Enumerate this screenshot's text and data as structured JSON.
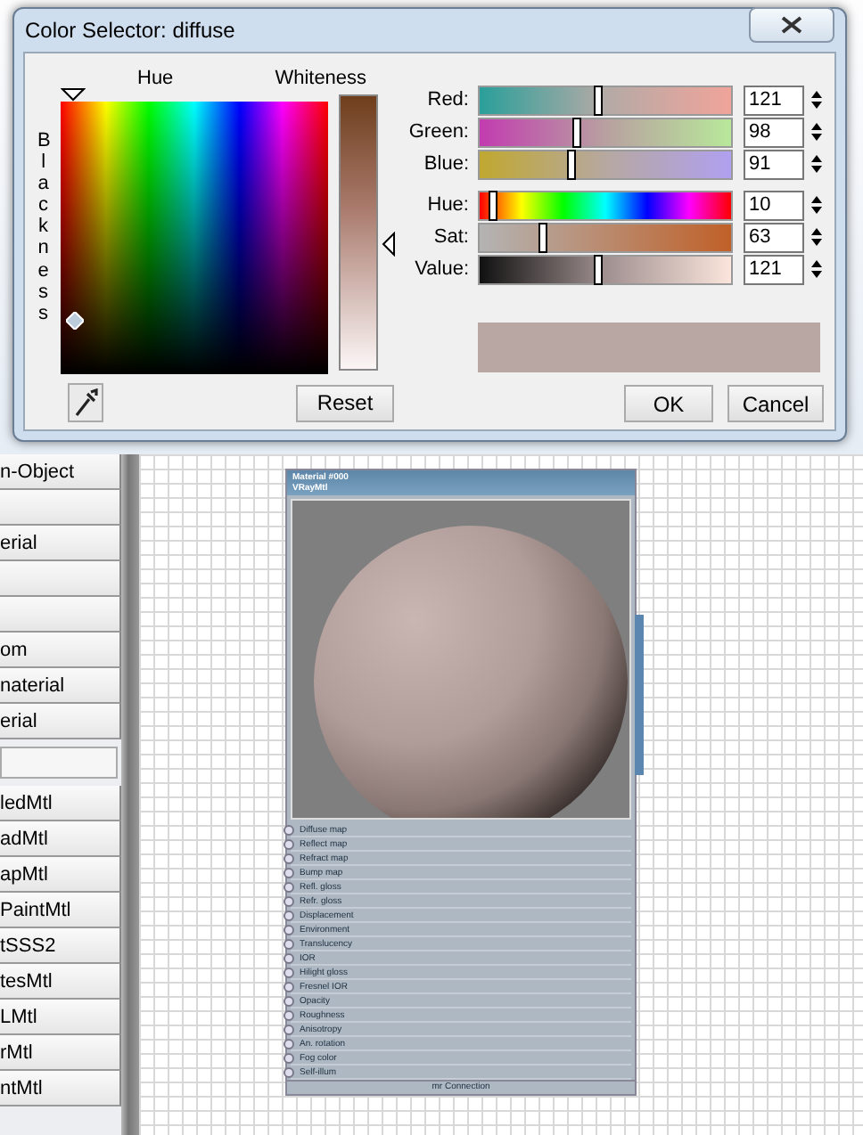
{
  "dialog": {
    "title": "Color Selector: diffuse",
    "hue_label": "Hue",
    "whiteness_label": "Whiteness",
    "blackness_label": "Blackness",
    "channels": [
      {
        "kind": "red",
        "name": "Red:",
        "level": 0.47,
        "value": "121"
      },
      {
        "kind": "green",
        "name": "Green:",
        "level": 0.38,
        "value": "98"
      },
      {
        "kind": "blue",
        "name": "Blue:",
        "level": 0.36,
        "value": "91"
      },
      {
        "kind": "hue",
        "name": "Hue:",
        "level": 0.05,
        "value": "10"
      },
      {
        "kind": "sat",
        "name": "Sat:",
        "level": 0.25,
        "value": "63"
      },
      {
        "kind": "value",
        "name": "Value:",
        "level": 0.47,
        "value": "121"
      }
    ],
    "reset": "Reset",
    "ok": "OK",
    "cancel": "Cancel"
  },
  "material_list": [
    {
      "kind": "button",
      "label": "n-Object"
    },
    {
      "kind": "button"
    },
    {
      "kind": "button",
      "label": "erial"
    },
    {
      "kind": "button"
    },
    {
      "kind": "button"
    },
    {
      "kind": "button",
      "label": "om"
    },
    {
      "kind": "button",
      "label": "naterial"
    },
    {
      "kind": "button",
      "label": "erial"
    },
    {
      "kind": "field"
    },
    {
      "kind": "button",
      "label": "ledMtl"
    },
    {
      "kind": "button",
      "label": "adMtl"
    },
    {
      "kind": "button",
      "label": "apMtl"
    },
    {
      "kind": "button",
      "label": "PaintMtl"
    },
    {
      "kind": "button",
      "label": "tSSS2"
    },
    {
      "kind": "button",
      "label": "tesMtl"
    },
    {
      "kind": "button",
      "label": "LMtl"
    },
    {
      "kind": "button",
      "label": "rMtl"
    },
    {
      "kind": "button",
      "label": "ntMtl"
    }
  ],
  "node": {
    "title": "Material #000",
    "type": "VRayMtl",
    "slots": [
      "Diffuse map",
      "Reflect map",
      "Refract map",
      "Bump map",
      "Refl. gloss",
      "Refr. gloss",
      "Displacement",
      "Environment",
      "Translucency",
      "IOR",
      "Hilight gloss",
      "Fresnel IOR",
      "Opacity",
      "Roughness",
      "Anisotropy",
      "An. rotation",
      "Fog color",
      "Self-illum"
    ],
    "footer": "mr Connection"
  }
}
